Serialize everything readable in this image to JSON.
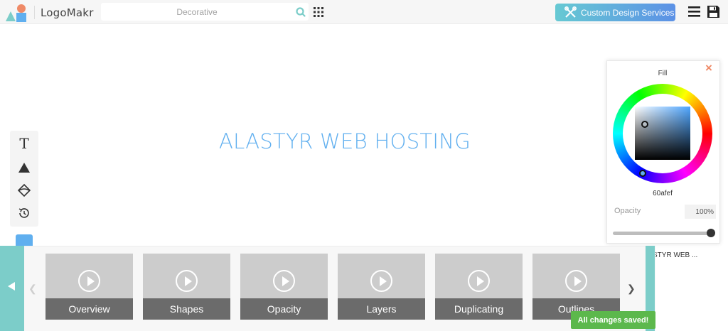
{
  "header": {
    "brand": "LogoMakr",
    "search": {
      "placeholder": "Decorative",
      "value": ""
    },
    "custom_design_label": "Custom Design Services"
  },
  "canvas": {
    "logo_text": "ALASTYR WEB HOSTING",
    "text_color": "#60afef"
  },
  "color_panel": {
    "title": "Fill",
    "close_label": "×",
    "hex": "60afef",
    "opacity_label": "Opacity",
    "opacity_value": "100%",
    "opacity_level": 1.0
  },
  "layers": {
    "item_label": "STYR WEB ..."
  },
  "videos": [
    {
      "caption": "Overview"
    },
    {
      "caption": "Shapes"
    },
    {
      "caption": "Opacity"
    },
    {
      "caption": "Layers"
    },
    {
      "caption": "Duplicating"
    },
    {
      "caption": "Outlines"
    }
  ],
  "toast": {
    "message": "All changes saved!"
  },
  "colors": {
    "accent": "#60afef",
    "teal": "#7ccdc9",
    "success": "#5cb84c",
    "close": "#ef8a67"
  },
  "icons": [
    "logo-shapes-icon",
    "search-icon",
    "grid-icon",
    "tools-icon",
    "menu-icon",
    "save-icon",
    "text-tool-icon",
    "shape-tool-icon",
    "fill-tool-icon",
    "history-icon",
    "play-icon",
    "chevron-left-icon",
    "chevron-right-icon"
  ]
}
